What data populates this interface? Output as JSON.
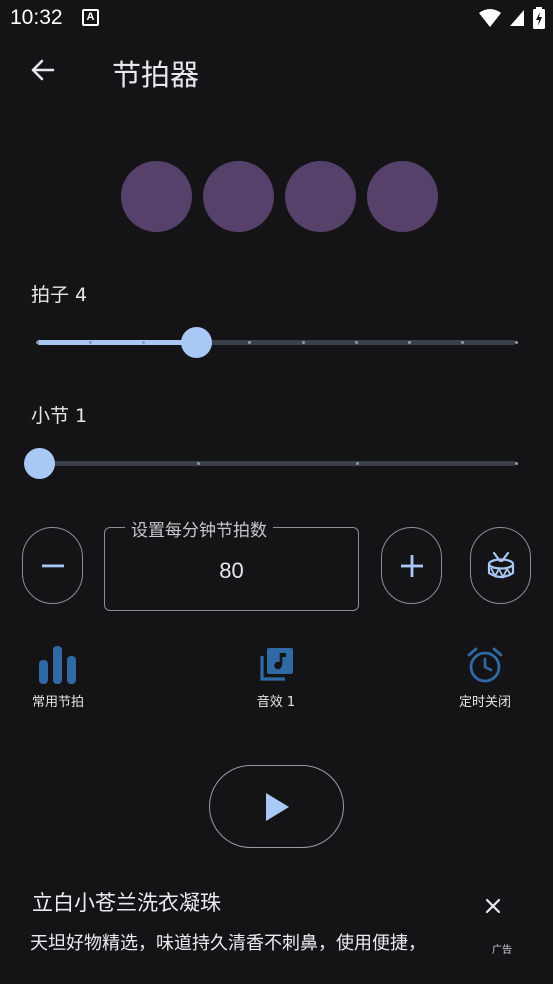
{
  "status_bar": {
    "time": "10:32",
    "notification_icon": "A"
  },
  "app_bar": {
    "title": "节拍器"
  },
  "beats": {
    "count": 4,
    "color": "#56416a"
  },
  "beat_slider": {
    "label": "拍子 4",
    "value": 4,
    "min": 1,
    "max": 10
  },
  "bar_slider": {
    "label": "小节 1",
    "value": 1,
    "min": 1,
    "max": 4
  },
  "bpm": {
    "label": "设置每分钟节拍数",
    "value": "80"
  },
  "tools": {
    "common_beats": "常用节拍",
    "sound": "音效 1",
    "timer": "定时关闭"
  },
  "ad": {
    "title": "立白小苍兰洗衣凝珠",
    "text": "天坦好物精选，味道持久清香不刺鼻，使用便捷，",
    "tag": "广告"
  },
  "colors": {
    "accent": "#a8c8f5",
    "icon_blue": "#2f6aa7",
    "background": "#141416"
  }
}
